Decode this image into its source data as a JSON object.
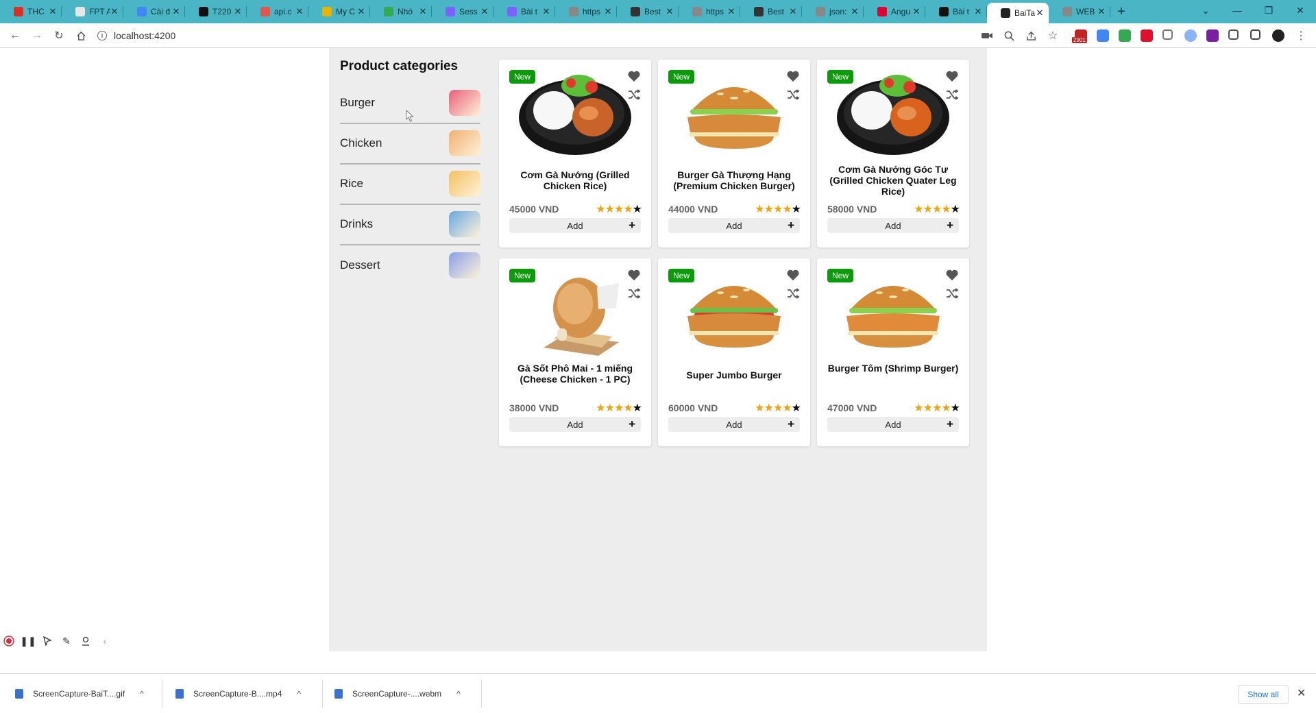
{
  "browser": {
    "tabs": [
      {
        "label": "THC",
        "color": "#d93025"
      },
      {
        "label": "FPT A",
        "color": "#e6e6e6"
      },
      {
        "label": "Cài đ",
        "color": "#4285f4"
      },
      {
        "label": "T220",
        "color": "#111111"
      },
      {
        "label": "api.c",
        "color": "#e0584b"
      },
      {
        "label": "My C",
        "color": "#e8b400"
      },
      {
        "label": "Nhó",
        "color": "#34a853"
      },
      {
        "label": "Sess",
        "color": "#7b61ff"
      },
      {
        "label": "Bài t",
        "color": "#7b61ff"
      },
      {
        "label": "https",
        "color": "#888888"
      },
      {
        "label": "Best",
        "color": "#333333"
      },
      {
        "label": "https",
        "color": "#888888"
      },
      {
        "label": "Best",
        "color": "#333333"
      },
      {
        "label": "json:",
        "color": "#888888"
      },
      {
        "label": "Angu",
        "color": "#dd0031"
      },
      {
        "label": "Bài t",
        "color": "#111111"
      },
      {
        "label": "BaiTa",
        "color": "#222222",
        "active": true
      },
      {
        "label": "WEB",
        "color": "#888888"
      }
    ],
    "address": "localhost:4200",
    "extensions": [
      {
        "name": "gmail-icon",
        "color": "#c5221f"
      },
      {
        "name": "translate-icon",
        "color": "#4285f4"
      },
      {
        "name": "drive-icon",
        "color": "#34a853"
      },
      {
        "name": "adblock-icon",
        "color": "#e0102a"
      },
      {
        "name": "camera-icon",
        "color": "#777777"
      },
      {
        "name": "lens-icon",
        "color": "#8ab4f8"
      },
      {
        "name": "extension-purple-icon",
        "color": "#7a1fa2"
      },
      {
        "name": "puzzle-icon",
        "color": "#555555"
      },
      {
        "name": "sidepanel-icon",
        "color": "#444444"
      },
      {
        "name": "profile-avatar",
        "color": "#222222"
      }
    ],
    "gmail_badge": "2901"
  },
  "categories": {
    "title": "Product categories",
    "items": [
      {
        "label": "Burger",
        "thumb_color": "#e8607a"
      },
      {
        "label": "Chicken",
        "thumb_color": "#f0b070"
      },
      {
        "label": "Rice",
        "thumb_color": "#f3c060"
      },
      {
        "label": "Drinks",
        "thumb_color": "#6aa8e0"
      },
      {
        "label": "Dessert",
        "thumb_color": "#8aa0e8"
      }
    ]
  },
  "products": [
    {
      "badge": "New",
      "name": "Cơm Gà Nướng (Grilled Chicken Rice)",
      "price": "45000 VND",
      "rating": 4,
      "add_label": "Add",
      "kind": "rice"
    },
    {
      "badge": "New",
      "name": "Burger Gà Thượng Hạng (Premium Chicken Burger)",
      "price": "44000 VND",
      "rating": 4,
      "add_label": "Add",
      "kind": "burger"
    },
    {
      "badge": "New",
      "name": "Cơm Gà Nướng Góc Tư (Grilled Chicken Quater Leg Rice)",
      "price": "58000 VND",
      "rating": 4,
      "add_label": "Add",
      "kind": "rice2"
    },
    {
      "badge": "New",
      "name": "Gà Sốt Phô Mai - 1 miếng (Cheese Chicken - 1 PC)",
      "price": "38000 VND",
      "rating": 4,
      "add_label": "Add",
      "kind": "chicken"
    },
    {
      "badge": "New",
      "name": "Super Jumbo Burger",
      "price": "60000 VND",
      "rating": 4,
      "add_label": "Add",
      "kind": "burger2"
    },
    {
      "badge": "New",
      "name": "Burger Tôm (Shrimp Burger)",
      "price": "47000 VND",
      "rating": 4,
      "add_label": "Add",
      "kind": "burger3"
    }
  ],
  "rating_max": 5,
  "downloads": [
    {
      "name": "ScreenCapture-BaiT....gif"
    },
    {
      "name": "ScreenCapture-B....mp4"
    },
    {
      "name": "ScreenCapture-....webm"
    }
  ],
  "downloads_show_all": "Show all"
}
